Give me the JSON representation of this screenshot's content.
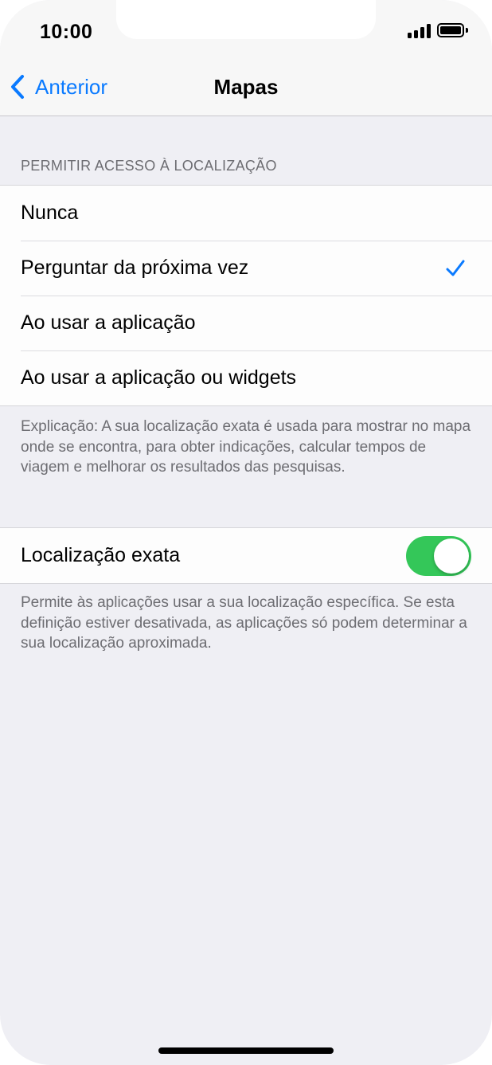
{
  "status_bar": {
    "time": "10:00",
    "signal_icon": "cellular-signal-icon",
    "battery_icon": "battery-icon",
    "battery_level": 1.0
  },
  "nav": {
    "back_label": "Anterior",
    "title": "Mapas"
  },
  "location_access": {
    "header": "PERMITIR ACESSO À LOCALIZAÇÃO",
    "options": [
      {
        "label": "Nunca",
        "selected": false
      },
      {
        "label": "Perguntar da próxima vez",
        "selected": true
      },
      {
        "label": "Ao usar a aplicação",
        "selected": false
      },
      {
        "label": "Ao usar a aplicação ou widgets",
        "selected": false
      }
    ],
    "footer": "Explicação: A sua localização exata é usada para mostrar no mapa onde se encontra, para obter indicações, calcular tempos de viagem e melhorar os resultados das pesquisas."
  },
  "precise_location": {
    "label": "Localização exata",
    "enabled": true,
    "footer": "Permite às aplicações usar a sua localização específica. Se esta definição estiver desativada, as aplicações só podem determinar a sua localização aproximada."
  },
  "colors": {
    "accent": "#0a7aff",
    "toggle_on": "#34c759",
    "background": "#efeff4"
  }
}
